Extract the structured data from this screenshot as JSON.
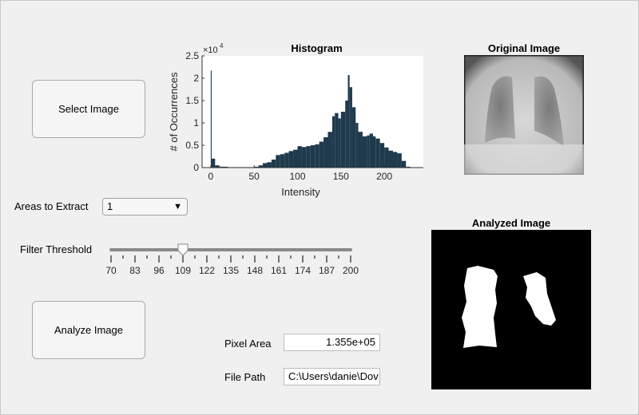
{
  "buttons": {
    "select_image": "Select Image",
    "analyze_image": "Analyze Image"
  },
  "areas": {
    "label": "Areas to Extract",
    "value": "1"
  },
  "filter": {
    "label": "Filter Threshold",
    "min": 70,
    "max": 200,
    "value": 109,
    "ticks": [
      "70",
      "83",
      "96",
      "109",
      "122",
      "135",
      "148",
      "161",
      "174",
      "187",
      "200"
    ]
  },
  "pixel_area": {
    "label": "Pixel Area",
    "value": "1.355e+05"
  },
  "file_path": {
    "label": "File Path",
    "value": "C:\\Users\\danie\\Dov"
  },
  "original_image": {
    "title": "Original Image"
  },
  "analyzed_image": {
    "title": "Analyzed Image"
  },
  "chart_data": {
    "type": "bar",
    "title": "Histogram",
    "xlabel": "Intensity",
    "ylabel": "# of Occurrences",
    "exponent_label": "×10",
    "exponent": "4",
    "xlim": [
      -10,
      245
    ],
    "ylim": [
      0,
      25000
    ],
    "xticks": [
      "0",
      "50",
      "100",
      "150",
      "200"
    ],
    "yticks": [
      "0",
      "0.5",
      "1",
      "1.5",
      "2",
      "2.5"
    ],
    "bar_color": "#1f3a4d",
    "x": [
      0,
      1,
      5,
      10,
      20,
      50,
      55,
      60,
      65,
      70,
      75,
      80,
      85,
      90,
      95,
      100,
      105,
      110,
      115,
      120,
      125,
      130,
      135,
      140,
      143,
      147,
      150,
      155,
      158,
      160,
      163,
      167,
      170,
      175,
      180,
      183,
      187,
      190,
      195,
      200,
      205,
      210,
      215,
      220,
      225,
      230
    ],
    "values": [
      21700,
      2000,
      500,
      200,
      100,
      200,
      500,
      1000,
      1200,
      1800,
      2800,
      3000,
      3300,
      3700,
      4000,
      4800,
      4600,
      4800,
      5000,
      5200,
      5800,
      6800,
      8000,
      11500,
      12200,
      11000,
      12500,
      15000,
      20700,
      18000,
      13500,
      10000,
      8000,
      7000,
      7200,
      7600,
      7000,
      6500,
      5500,
      4500,
      3800,
      3500,
      3200,
      1500,
      200,
      0
    ]
  }
}
